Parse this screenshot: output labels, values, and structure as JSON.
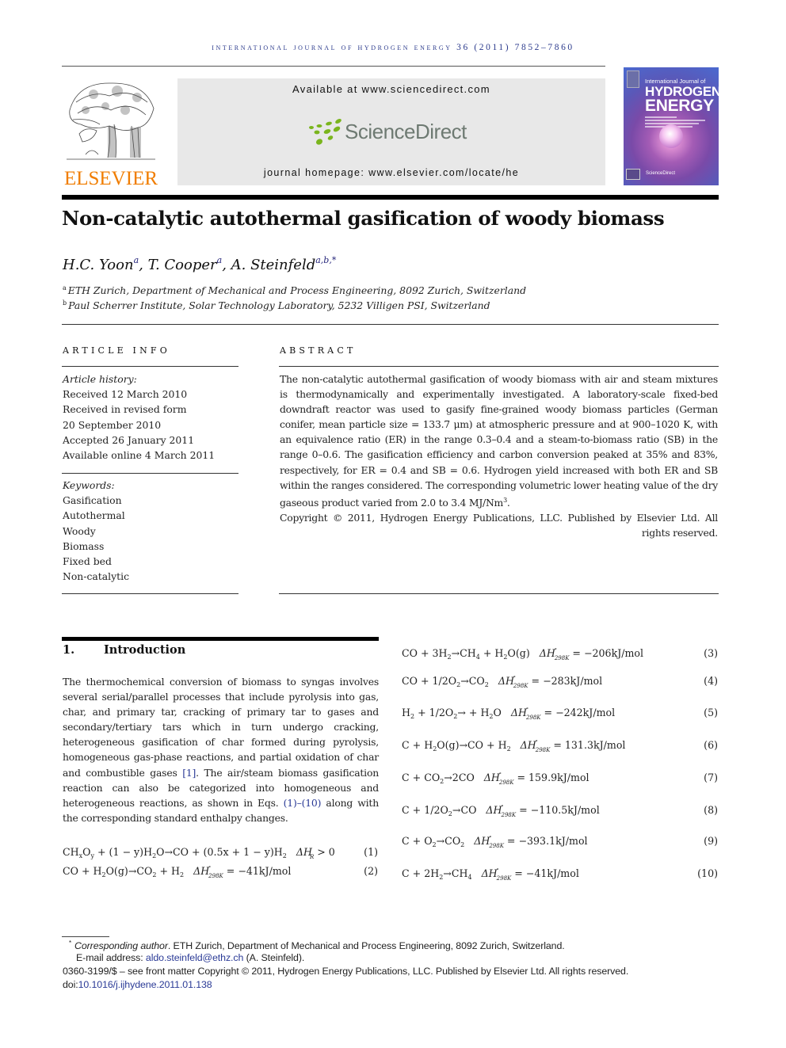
{
  "journal": {
    "running_head": "international journal of hydrogen energy 36 (2011) 7852–7860",
    "publisher_logo_text": "ELSEVIER",
    "available_at": "Available at www.sciencedirect.com",
    "sciencedirect_logo_text": "ScienceDirect",
    "homepage": "journal homepage: www.elsevier.com/locate/he",
    "cover": {
      "title_small": "International Journal of",
      "title_line1": "HYDROGEN",
      "title_line2": "ENERGY",
      "footer_text": "ScienceDirect",
      "colors": {
        "primary": "#5a58b8",
        "accent": "#d88ad0"
      }
    },
    "colors": {
      "running_head": "#2b3a8c",
      "elsevier_orange": "#f07d00",
      "sd_green": "#7ab51d",
      "link": "#2a3a96"
    }
  },
  "article": {
    "title": "Non-catalytic autothermal gasification of woody biomass",
    "authors": [
      {
        "name": "H.C. Yoon",
        "affil": "a",
        "sep": ", "
      },
      {
        "name": "T. Cooper",
        "affil": "a",
        "sep": ", "
      },
      {
        "name": "A. Steinfeld",
        "affil": "a,b,*",
        "sep": ""
      }
    ],
    "affiliations": [
      {
        "mark": "a",
        "text": "ETH Zurich, Department of Mechanical and Process Engineering, 8092 Zurich, Switzerland"
      },
      {
        "mark": "b",
        "text": "Paul Scherrer Institute, Solar Technology Laboratory, 5232 Villigen PSI, Switzerland"
      }
    ]
  },
  "article_info": {
    "heading": "ARTICLE INFO",
    "history_label": "Article history:",
    "history": [
      "Received 12 March 2010",
      "Received in revised form",
      "20 September 2010",
      "Accepted 26 January 2011",
      "Available online 4 March 2011"
    ],
    "keywords_label": "Keywords:",
    "keywords": [
      "Gasification",
      "Autothermal",
      "Woody",
      "Biomass",
      "Fixed bed",
      "Non-catalytic"
    ]
  },
  "abstract": {
    "heading": "ABSTRACT",
    "body": "The non-catalytic autothermal gasification of woody biomass with air and steam mixtures is thermodynamically and experimentally investigated. A laboratory-scale fixed-bed downdraft reactor was used to gasify fine-grained woody biomass particles (German conifer, mean particle size = 133.7 μm) at atmospheric pressure and at 900–1020 K, with an equivalence ratio (ER) in the range 0.3–0.4 and a steam-to-biomass ratio (SB) in the range 0–0.6. The gasification efficiency and carbon conversion peaked at 35% and 83%, respectively, for ER = 0.4 and SB = 0.6. Hydrogen yield increased with both ER and SB within the ranges considered. The corresponding volumetric lower heating value of the dry gaseous product varied from 2.0 to 3.4 MJ/Nm",
    "body_sup": "3",
    "body_end": ".",
    "copyright": "Copyright © 2011, Hydrogen Energy Publications, LLC. Published by Elsevier Ltd. All rights reserved."
  },
  "introduction": {
    "number": "1.",
    "title": "Introduction",
    "para_a": "The thermochemical conversion of biomass to syngas involves several serial/parallel processes that include pyrolysis into gas, char, and primary tar, cracking of primary tar to gases and secondary/tertiary tars which in turn undergo cracking, heterogeneous gasification of char formed during pyrolysis, homogeneous gas-phase reactions, and partial oxidation of char and combustible gases ",
    "ref1": "[1]",
    "para_b": ". The air/steam biomass gasification reaction can also be categorized into homogeneous and heterogeneous reactions, as shown in Eqs. ",
    "eq_ref": "(1)–(10)",
    "para_c": " along with the corresponding standard enthalpy changes."
  },
  "equations": [
    {
      "num": "(1)",
      "delta": "ΔH",
      "delta_sub": "R",
      "rhs": " > 0"
    },
    {
      "num": "(2)",
      "value": " = −41kJ/mol"
    },
    {
      "num": "(3)",
      "value": " = −206kJ/mol"
    },
    {
      "num": "(4)",
      "value": " = −283kJ/mol"
    },
    {
      "num": "(5)",
      "value": " = −242kJ/mol"
    },
    {
      "num": "(6)",
      "value": " = 131.3kJ/mol"
    },
    {
      "num": "(7)",
      "value": " = 159.9kJ/mol"
    },
    {
      "num": "(8)",
      "value": " = −110.5kJ/mol"
    },
    {
      "num": "(9)",
      "value": " = −393.1kJ/mol"
    },
    {
      "num": "(10)",
      "value": " = −41kJ/mol"
    }
  ],
  "enthalpy_symbol": {
    "delta": "ΔH",
    "sup": "°",
    "sub": "298K"
  },
  "footnotes": {
    "star": "*",
    "corresponding_label": "Corresponding author",
    "corresponding_text": ". ETH Zurich, Department of Mechanical and Process Engineering, 8092 Zurich, Switzerland.",
    "email_label": "E-mail address: ",
    "email": "aldo.steinfeld@ethz.ch",
    "email_suffix": " (A. Steinfeld).",
    "issn_line": "0360-3199/$ – see front matter Copyright © 2011, Hydrogen Energy Publications, LLC. Published by Elsevier Ltd. All rights reserved.",
    "doi_label": "doi:",
    "doi": "10.1016/j.ijhydene.2011.01.138"
  }
}
